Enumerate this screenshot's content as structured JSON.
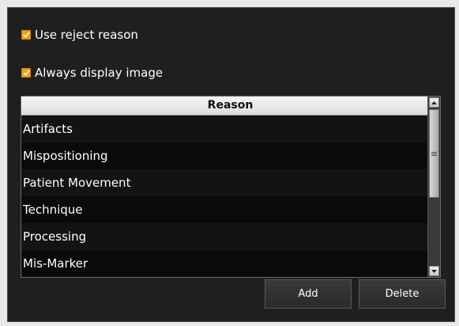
{
  "options": {
    "use_reject_reason": {
      "label": "Use reject reason",
      "checked": true
    },
    "always_display_image": {
      "label": "Always display image",
      "checked": true
    }
  },
  "table": {
    "header": "Reason",
    "rows": [
      "Artifacts",
      "Mispositioning",
      "Patient Movement",
      "Technique",
      "Processing",
      "Mis-Marker"
    ]
  },
  "buttons": {
    "add_label": "Add",
    "delete_label": "Delete"
  },
  "colors": {
    "checkbox": "#f2a20c",
    "panel_background": "#1f1f1f"
  },
  "icons": {
    "checkbox_mark": "check-icon",
    "scroll_up": "arrow-up-icon",
    "scroll_down": "arrow-down-icon",
    "scroll_grip": "grip-icon"
  }
}
